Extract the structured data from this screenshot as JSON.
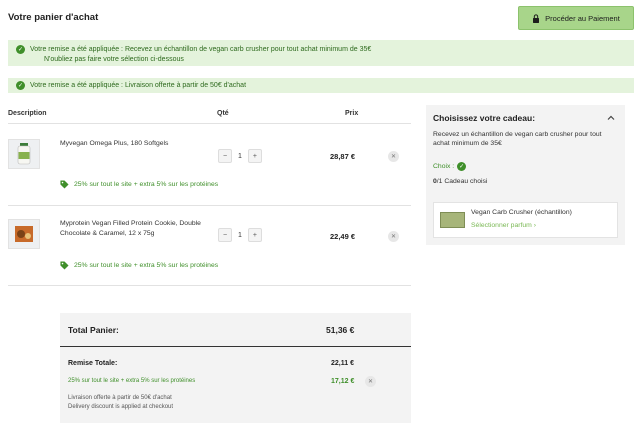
{
  "header": {
    "title": "Votre panier d'achat",
    "checkout_label": "Procéder au Paiement"
  },
  "alerts": [
    {
      "line1": "Votre remise a été appliquée : Recevez un échantillon de vegan carb crusher pour tout achat minimum de 35€",
      "line2": "N'oubliez pas faire votre sélection ci-dessous"
    },
    {
      "line1": "Votre remise a été appliquée : Livraison offerte à partir de 50€ d'achat"
    }
  ],
  "columns": {
    "description": "Description",
    "qty": "Qté",
    "price": "Prix"
  },
  "items": [
    {
      "name": "Myvegan Omega Plus, 180 Softgels",
      "qty": "1",
      "price": "28,87 €",
      "promo": "25% sur tout le site + extra 5% sur les protéines"
    },
    {
      "name": "Myprotein Vegan Filled Protein Cookie, Double Chocolate & Caramel, 12 x 75g",
      "qty": "1",
      "price": "22,49 €",
      "promo": "25% sur tout le site + extra 5% sur les protéines"
    }
  ],
  "qty_controls": {
    "minus": "−",
    "plus": "+"
  },
  "totals": {
    "total_label": "Total Panier:",
    "total_value": "51,36 €",
    "discount_label": "Remise Totale:",
    "discount_value": "22,11 €",
    "promo_line": "25% sur tout le site + extra 5% sur les protéines",
    "promo_value": "17,12 €",
    "shipping_line1": "Livraison offerte à partir de 50€ d'achat",
    "shipping_line2": "Delivery discount is applied at checkout"
  },
  "gift": {
    "title": "Choisissez votre cadeau:",
    "description": "Recevez un échantillon de vegan carb crusher pour tout achat minimum de 35€",
    "choice_label": "Choix :",
    "count_num": "0",
    "count_text": "/1 Cadeau choisi",
    "product_name": "Vegan Carb Crusher (échantillon)",
    "select_label": "Sélectionner parfum ›"
  },
  "colors": {
    "accent_green": "#3f8f2a",
    "button_green": "#a8d58a",
    "alert_bg": "#e4f3dc"
  }
}
